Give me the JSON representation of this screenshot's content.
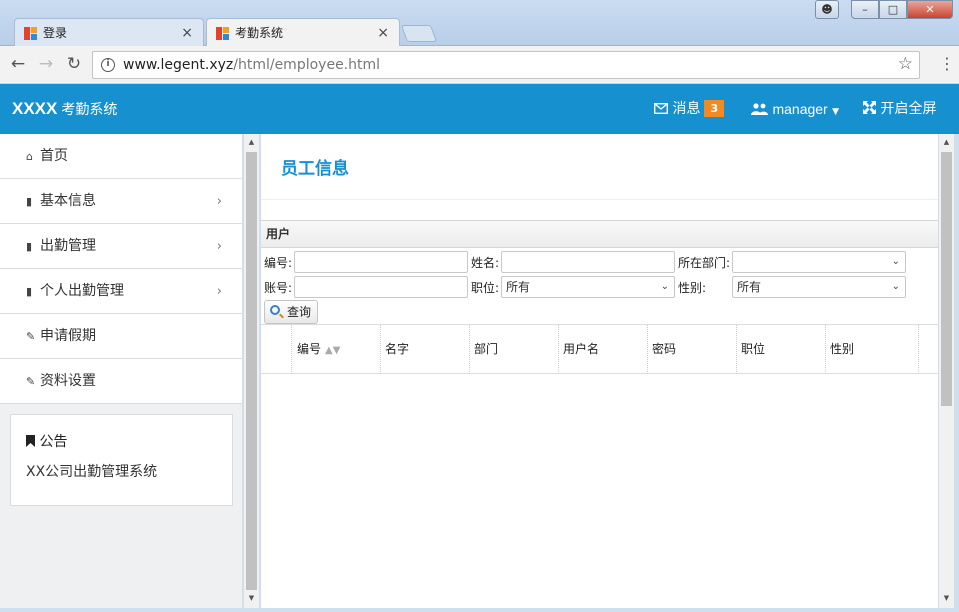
{
  "browser": {
    "tabs": [
      {
        "title": "登录",
        "active": false
      },
      {
        "title": "考勤系统",
        "active": true
      }
    ],
    "tab_close": "×",
    "url_host": "www.legent.xyz",
    "url_path": "/html/employee.html"
  },
  "header": {
    "brand_bold": "XXXX",
    "brand_text": "考勤系统",
    "messages_label": "消息",
    "messages_count": "3",
    "user": "manager",
    "fullscreen": "开启全屏",
    "color": "#1790d0"
  },
  "sidebar": {
    "items": [
      {
        "label": "首页",
        "icon": "home-icon",
        "has_submenu": false
      },
      {
        "label": "基本信息",
        "icon": "file-icon",
        "has_submenu": true
      },
      {
        "label": "出勤管理",
        "icon": "file-icon",
        "has_submenu": true
      },
      {
        "label": "个人出勤管理",
        "icon": "file-icon",
        "has_submenu": true
      },
      {
        "label": "申请假期",
        "icon": "edit-icon",
        "has_submenu": false
      },
      {
        "label": "资料设置",
        "icon": "edit-icon",
        "has_submenu": false
      }
    ],
    "notice_title": "公告",
    "notice_body": "XX公司出勤管理系统"
  },
  "main": {
    "page_title": "员工信息",
    "panel_title": "用户",
    "form": {
      "number_label": "编号:",
      "name_label": "姓名:",
      "dept_label": "所在部门:",
      "account_label": "账号:",
      "position_label": "职位:",
      "position_value": "所有",
      "gender_label": "性别:",
      "gender_value": "所有",
      "search_button": "查询"
    },
    "table_columns": [
      "编号",
      "名字",
      "部门",
      "用户名",
      "密码",
      "职位",
      "性别"
    ]
  }
}
